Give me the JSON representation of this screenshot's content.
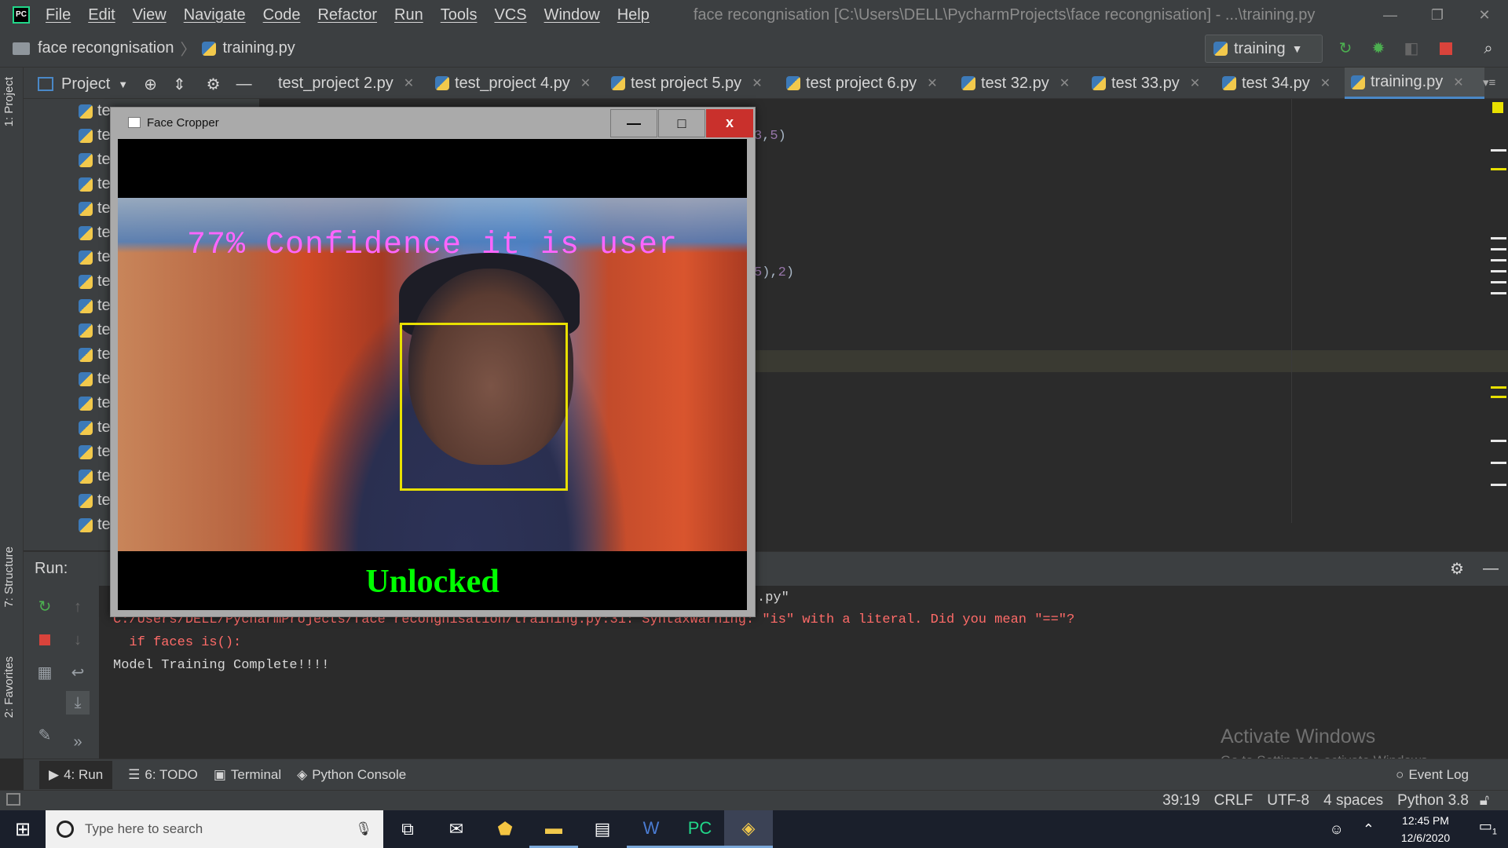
{
  "titlebar": {
    "menu": [
      "File",
      "Edit",
      "View",
      "Navigate",
      "Code",
      "Refactor",
      "Run",
      "Tools",
      "VCS",
      "Window",
      "Help"
    ],
    "window_title": "face recongnisation [C:\\Users\\DELL\\PycharmProjects\\face recongnisation] - ...\\training.py",
    "controls": {
      "minimize": "—",
      "restore": "❐",
      "close": "✕"
    }
  },
  "navbar": {
    "project": "face recongnisation",
    "file": "training.py",
    "run_config": "training"
  },
  "project_panel": {
    "title": "Project",
    "tree_items": [
      "te",
      "te",
      "te",
      "te",
      "te",
      "te",
      "te",
      "te",
      "te",
      "te",
      "te",
      "te",
      "te",
      "te",
      "te",
      "te",
      "te",
      "te"
    ]
  },
  "left_stripe": {
    "project": "1: Project",
    "structure": "7: Structure",
    "favorites": "2: Favorites"
  },
  "tabs": [
    {
      "label": "test_project 2.py"
    },
    {
      "label": "test_project 4.py"
    },
    {
      "label": "test project 5.py"
    },
    {
      "label": "test project 6.py"
    },
    {
      "label": "test 32.py"
    },
    {
      "label": "test 33.py"
    },
    {
      "label": "test 34.py"
    },
    {
      "label": "training.py"
    }
  ],
  "editor": {
    "line1_num": "3",
    "line1_sep": ",",
    "line1_num2": "5",
    "line1_end": ")",
    "line2_num": "5",
    "line2_mid": "),",
    "line2_num2": "2",
    "line2_end": ")"
  },
  "run_panel": {
    "label": "Run:",
    "console": [
      {
        "text": ".py\"",
        "kind": "out"
      },
      {
        "text": "C:/Users/DELL/PycharmProjects/face recongnisation/training.py:31: SyntaxWarning: \"is\" with a literal. Did you mean \"==\"?",
        "kind": "err"
      },
      {
        "text": "  if faces is():",
        "kind": "err"
      },
      {
        "text": "Model Training Complete!!!!",
        "kind": "out"
      }
    ]
  },
  "watermark": {
    "title": "Activate Windows",
    "subtitle": "Go to Settings to activate Windows."
  },
  "bottom_tabs": {
    "run": "4: Run",
    "todo": "6: TODO",
    "terminal": "Terminal",
    "python_console": "Python Console",
    "event_log": "Event Log"
  },
  "statusbar": {
    "position": "39:19",
    "line_sep": "CRLF",
    "encoding": "UTF-8",
    "indent": "4 spaces",
    "interpreter": "Python 3.8"
  },
  "face_window": {
    "title": "Face Cropper",
    "confidence_text": "77% Confidence it is user",
    "status_text": "Unlocked",
    "controls": {
      "minimize": "—",
      "maximize": "□",
      "close": "x"
    }
  },
  "taskbar": {
    "search_placeholder": "Type here to search",
    "time": "12:45 PM",
    "date": "12/6/2020",
    "notification_count": "1"
  }
}
